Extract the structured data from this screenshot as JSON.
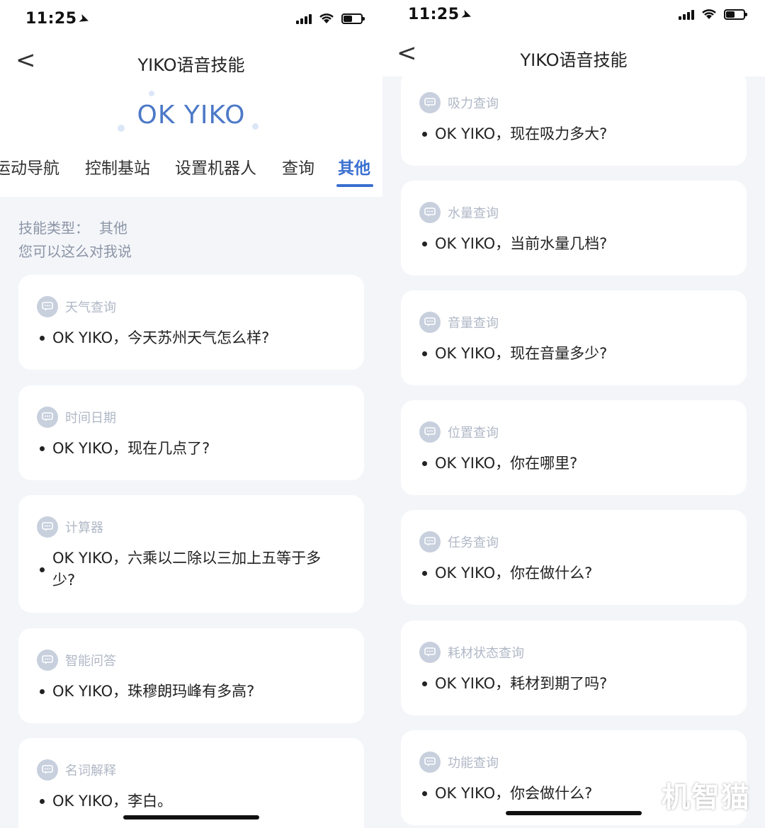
{
  "left": {
    "status": {
      "time": "11:25"
    },
    "nav": {
      "back": "<",
      "title": "YIKO语音技能"
    },
    "hero": {
      "text": "OK YIKO"
    },
    "tabs": [
      "运动导航",
      "控制基站",
      "设置机器人",
      "查询",
      "其他"
    ],
    "active_tab": "其他",
    "skill_type_label": "技能类型：",
    "skill_type_value": "其他",
    "subtitle": "您可以这么对我说",
    "cards": [
      {
        "label": "天气查询",
        "text": "OK YIKO，今天苏州天气怎么样?"
      },
      {
        "label": "时间日期",
        "text": "OK YIKO，现在几点了?"
      },
      {
        "label": "计算器",
        "text_line1": "OK YIKO，六乘以二除以三加上五等于多",
        "text_line2": "少?"
      },
      {
        "label": "智能问答",
        "text": "OK YIKO，珠穆朗玛峰有多高?"
      },
      {
        "label": "名词解释",
        "text": "OK YIKO，李白。"
      }
    ]
  },
  "right": {
    "status": {
      "time": "11:25"
    },
    "nav": {
      "back": "<",
      "title": "YIKO语音技能"
    },
    "cards": [
      {
        "label": "吸力查询",
        "text": "OK YIKO，现在吸力多大?"
      },
      {
        "label": "水量查询",
        "text": "OK YIKO，当前水量几档?"
      },
      {
        "label": "音量查询",
        "text": "OK YIKO，现在音量多少?"
      },
      {
        "label": "位置查询",
        "text": "OK YIKO，你在哪里?"
      },
      {
        "label": "任务查询",
        "text": "OK YIKO，你在做什么?"
      },
      {
        "label": "耗材状态查询",
        "text": "OK YIKO，耗材到期了吗?"
      },
      {
        "label": "功能查询",
        "text": "OK YIKO，你会做什么?"
      }
    ]
  },
  "watermark": "机智猫",
  "colors": {
    "accent": "#3a6fd0",
    "label": "#b0b8c6",
    "background": "#f3f5f9"
  },
  "icons": {
    "back": "chevron-left-icon",
    "card": "chat-bubble-icon",
    "location": "location-arrow-icon"
  }
}
